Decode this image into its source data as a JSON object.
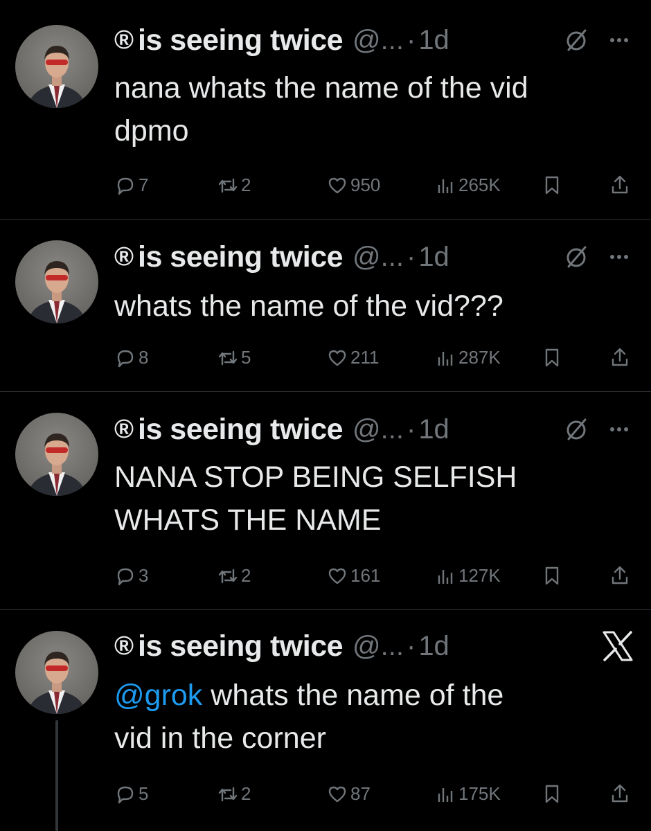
{
  "tweets": [
    {
      "reg": "®",
      "name": "is seeing twice",
      "handle": "@...",
      "dot": "·",
      "time": "1d",
      "text_line1": "nana whats the name of the vid",
      "text_line2": "dpmo",
      "replies": "7",
      "retweets": "2",
      "likes": "950",
      "views": "265K",
      "icons": [
        "grok-icon",
        "more-icon"
      ]
    },
    {
      "reg": "®",
      "name": "is seeing twice",
      "handle": "@...",
      "dot": "·",
      "time": "1d",
      "text_line1": "whats the name of the vid???",
      "replies": "8",
      "retweets": "5",
      "likes": "211",
      "views": "287K",
      "icons": [
        "grok-icon",
        "more-icon"
      ]
    },
    {
      "reg": "®",
      "name": "is seeing twice",
      "handle": "@...",
      "dot": "·",
      "time": "1d",
      "text_line1": "NANA STOP BEING SELFISH",
      "text_line2": "WHATS THE NAME",
      "replies": "3",
      "retweets": "2",
      "likes": "161",
      "views": "127K",
      "icons": [
        "grok-icon",
        "more-icon"
      ]
    },
    {
      "reg": "®",
      "name": "is seeing twice",
      "handle": "@...",
      "dot": "·",
      "time": "1d",
      "mention": "@grok",
      "text_line1_rest": " whats the name of the",
      "text_line2": "vid in the corner",
      "replies": "5",
      "retweets": "2",
      "likes": "87",
      "views": "175K",
      "icons": [
        "x-logo-icon"
      ]
    }
  ],
  "colors": {
    "background": "#000000",
    "text": "#e7e9ea",
    "secondary": "#71767b",
    "mention": "#1d9bf0",
    "divider": "#2f3336"
  }
}
